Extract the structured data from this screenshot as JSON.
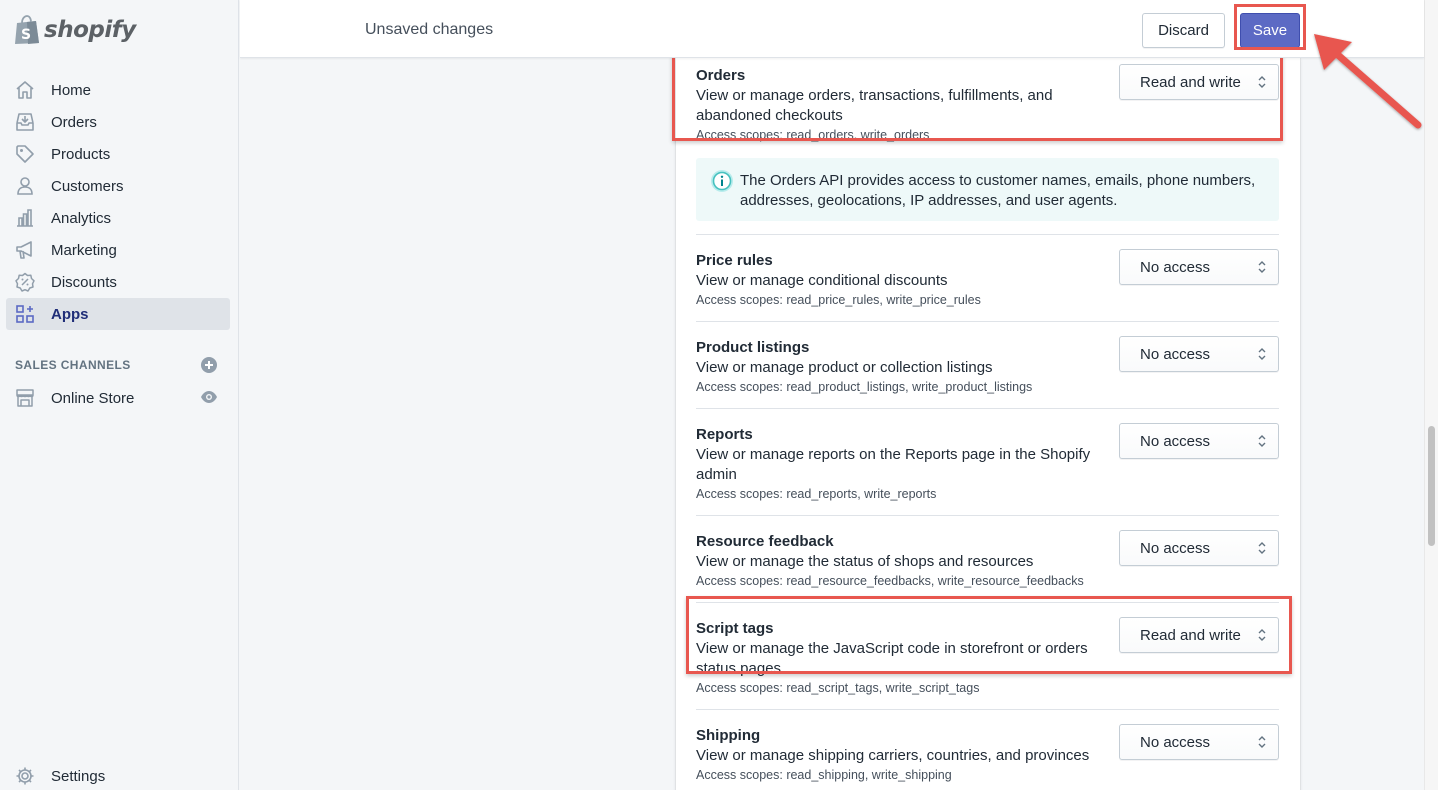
{
  "brand": {
    "name": "shopify"
  },
  "sidebar": {
    "items": [
      {
        "label": "Home",
        "icon": "home-icon"
      },
      {
        "label": "Orders",
        "icon": "orders-icon"
      },
      {
        "label": "Products",
        "icon": "tag-icon"
      },
      {
        "label": "Customers",
        "icon": "person-icon"
      },
      {
        "label": "Analytics",
        "icon": "analytics-icon"
      },
      {
        "label": "Marketing",
        "icon": "megaphone-icon"
      },
      {
        "label": "Discounts",
        "icon": "discount-icon"
      },
      {
        "label": "Apps",
        "icon": "apps-icon",
        "active": true
      }
    ],
    "sales_channels_title": "SALES CHANNELS",
    "online_store": "Online Store",
    "settings": "Settings"
  },
  "topbar": {
    "status": "Unsaved changes",
    "discard_label": "Discard",
    "save_label": "Save"
  },
  "permissions": {
    "orders": {
      "title": "Orders",
      "desc": "View or manage orders, transactions, fulfillments, and abandoned checkouts",
      "scopes": "Access scopes: read_orders, write_orders",
      "value": "Read and write"
    },
    "orders_notice": "The Orders API provides access to customer names, emails, phone numbers, addresses, geolocations, IP addresses, and user agents.",
    "price_rules": {
      "title": "Price rules",
      "desc": "View or manage conditional discounts",
      "scopes": "Access scopes: read_price_rules, write_price_rules",
      "value": "No access"
    },
    "product_listings": {
      "title": "Product listings",
      "desc": "View or manage product or collection listings",
      "scopes": "Access scopes: read_product_listings, write_product_listings",
      "value": "No access"
    },
    "reports": {
      "title": "Reports",
      "desc": "View or manage reports on the Reports page in the Shopify admin",
      "scopes": "Access scopes: read_reports, write_reports",
      "value": "No access"
    },
    "resource_feedback": {
      "title": "Resource feedback",
      "desc": "View or manage the status of shops and resources",
      "scopes": "Access scopes: read_resource_feedbacks, write_resource_feedbacks",
      "value": "No access"
    },
    "script_tags": {
      "title": "Script tags",
      "desc": "View or manage the JavaScript code in storefront or orders status pages",
      "scopes": "Access scopes: read_script_tags, write_script_tags",
      "value": "Read and write"
    },
    "shipping": {
      "title": "Shipping",
      "desc": "View or manage shipping carriers, countries, and provinces",
      "scopes": "Access scopes: read_shipping, write_shipping",
      "value": "No access"
    }
  },
  "colors": {
    "accent": "#5c6ac4",
    "highlight": "#e8574f",
    "banner_bg": "#eef9f9"
  }
}
